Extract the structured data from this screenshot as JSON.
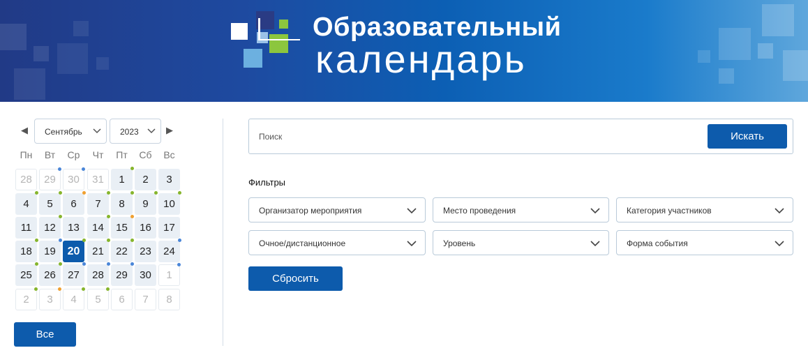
{
  "banner": {
    "title_line1": "Образовательный",
    "title_line2": "календарь"
  },
  "calendar": {
    "prev_icon": "triangle-left-icon",
    "next_icon": "triangle-right-icon",
    "month": "Сентябрь",
    "year": "2023",
    "weekdays": [
      "Пн",
      "Вт",
      "Ср",
      "Чт",
      "Пт",
      "Сб",
      "Вс"
    ],
    "today": "20",
    "dot_colors": {
      "blue": "#4a86d8",
      "green": "#86b52c",
      "orange": "#f0a030"
    },
    "weeks": [
      [
        {
          "d": "28",
          "other": true
        },
        {
          "d": "29",
          "other": true,
          "dot": "blue"
        },
        {
          "d": "30",
          "other": true,
          "dot": "blue"
        },
        {
          "d": "31",
          "other": true
        },
        {
          "d": "1",
          "dot": "green"
        },
        {
          "d": "2"
        },
        {
          "d": "3"
        }
      ],
      [
        {
          "d": "4",
          "dot": "green"
        },
        {
          "d": "5",
          "dot": "green"
        },
        {
          "d": "6",
          "dot": "orange"
        },
        {
          "d": "7",
          "dot": "green"
        },
        {
          "d": "8",
          "dot": "green"
        },
        {
          "d": "9",
          "dot": "green"
        },
        {
          "d": "10",
          "dot": "green"
        }
      ],
      [
        {
          "d": "11"
        },
        {
          "d": "12",
          "dot": "green"
        },
        {
          "d": "13"
        },
        {
          "d": "14",
          "dot": "green"
        },
        {
          "d": "15",
          "dot": "orange"
        },
        {
          "d": "16"
        },
        {
          "d": "17"
        }
      ],
      [
        {
          "d": "18",
          "dot": "green"
        },
        {
          "d": "19",
          "dot": "blue"
        },
        {
          "d": "20",
          "today": true,
          "dot": "green"
        },
        {
          "d": "21",
          "dot": "green"
        },
        {
          "d": "22",
          "dot": "green"
        },
        {
          "d": "23"
        },
        {
          "d": "24",
          "dot": "blue"
        }
      ],
      [
        {
          "d": "25",
          "dot": "green"
        },
        {
          "d": "26",
          "dot": "green"
        },
        {
          "d": "27",
          "dot": "blue"
        },
        {
          "d": "28",
          "dot": "blue"
        },
        {
          "d": "29",
          "dot": "blue"
        },
        {
          "d": "30"
        },
        {
          "d": "1",
          "other": true,
          "dot": "blue"
        }
      ],
      [
        {
          "d": "2",
          "other": true,
          "dot": "green"
        },
        {
          "d": "3",
          "other": true,
          "dot": "orange"
        },
        {
          "d": "4",
          "other": true,
          "dot": "green"
        },
        {
          "d": "5",
          "other": true,
          "dot": "green"
        },
        {
          "d": "6",
          "other": true
        },
        {
          "d": "7",
          "other": true
        },
        {
          "d": "8",
          "other": true
        }
      ]
    ],
    "all_button": "Все"
  },
  "search": {
    "placeholder": "Поиск",
    "button": "Искать"
  },
  "filters": {
    "label": "Фильтры",
    "selects": [
      "Организатор мероприятия",
      "Место проведения",
      "Категория участников",
      "Очное/дистанционное",
      "Уровень",
      "Форма события"
    ],
    "reset_button": "Сбросить"
  },
  "colors": {
    "accent": "#0d5bac",
    "day_bg": "#e9eff5",
    "border": "#b9cad9"
  }
}
